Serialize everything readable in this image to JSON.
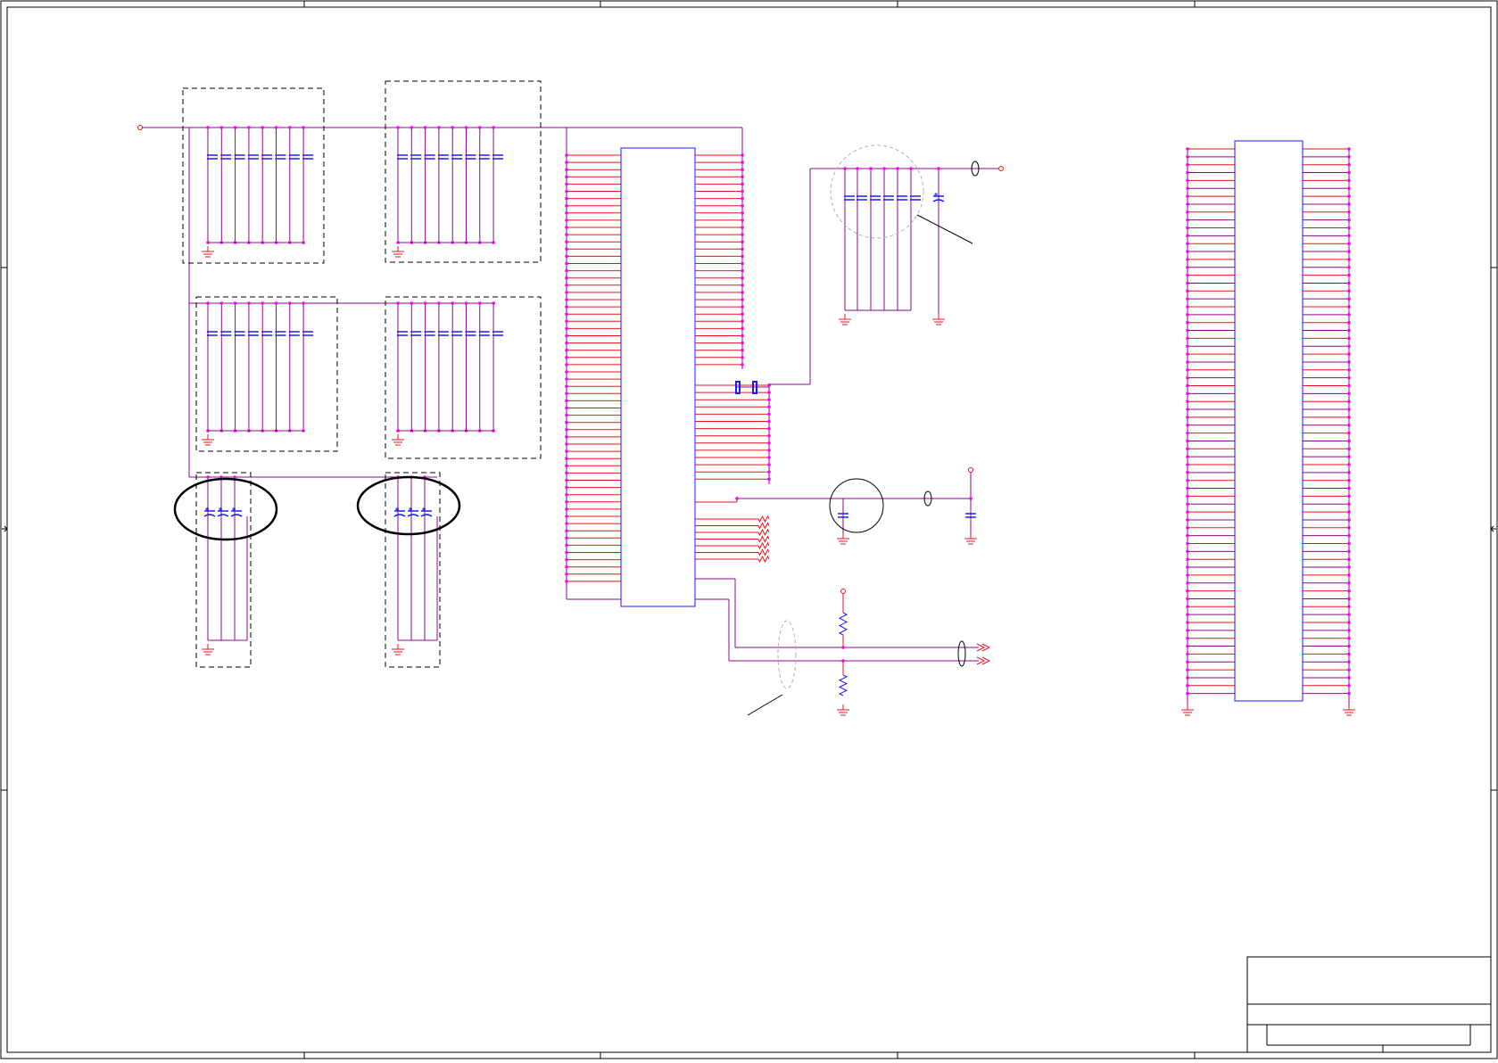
{
  "title_block": {
    "title_text": "",
    "rev_text": ""
  },
  "colors": {
    "wire": "#8b0a8b",
    "pin": "#e8141c",
    "part": "#1a1aff",
    "junction": "#ff00ff",
    "frame": "#000000",
    "annotation": "#000000",
    "dim": "#b0b0b0"
  }
}
